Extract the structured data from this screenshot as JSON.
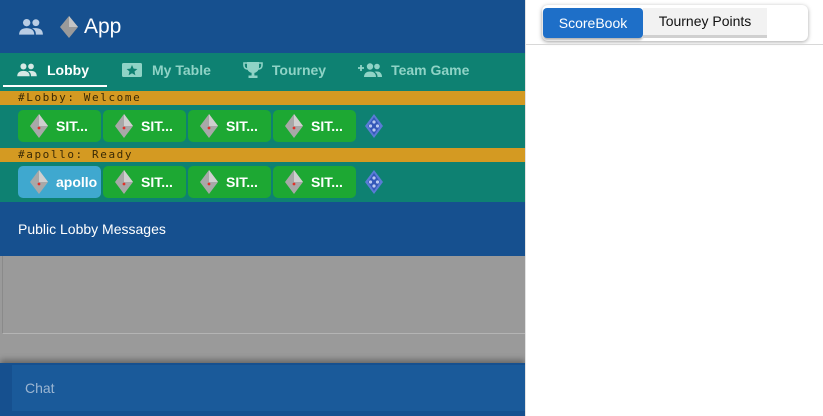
{
  "app": {
    "title": "App"
  },
  "nav": {
    "tabs": [
      {
        "label": "Lobby",
        "icon": "people-icon",
        "active": true
      },
      {
        "label": "My Table",
        "icon": "star-ticket-icon",
        "active": false
      },
      {
        "label": "Tourney",
        "icon": "trophy-icon",
        "active": false
      },
      {
        "label": "Team Game",
        "icon": "add-group-icon",
        "active": false
      }
    ]
  },
  "tables": [
    {
      "channel": "#Lobby: Welcome",
      "seats": [
        {
          "label": "SIT..."
        },
        {
          "label": "SIT..."
        },
        {
          "label": "SIT..."
        },
        {
          "label": "SIT..."
        }
      ]
    },
    {
      "channel": "#apollo: Ready",
      "seats": [
        {
          "label": "apollo"
        },
        {
          "label": "SIT..."
        },
        {
          "label": "SIT..."
        },
        {
          "label": "SIT..."
        }
      ]
    }
  ],
  "lobby": {
    "messages_title": "Public Lobby Messages"
  },
  "chat": {
    "placeholder": "Chat"
  },
  "scorepanel": {
    "tabs": [
      {
        "label": "ScoreBook",
        "active": true
      },
      {
        "label": "Tourney Points",
        "active": false
      }
    ]
  },
  "colors": {
    "appbar": "#16508f",
    "teal": "#0e8172",
    "channel_bar": "#d49a22",
    "seat_open": "#1da833",
    "seat_taken": "#3fa8cf",
    "toggle_active": "#1e6fc8"
  }
}
